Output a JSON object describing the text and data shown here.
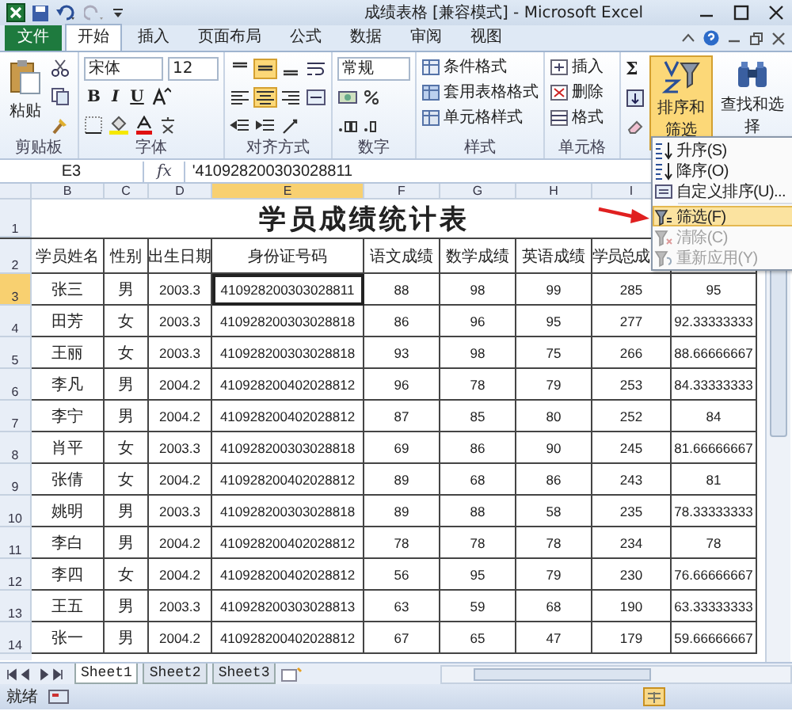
{
  "window": {
    "title": "成绩表格 [兼容模式] - Microsoft Excel"
  },
  "tabs": [
    {
      "label": "文件",
      "kind": "file",
      "selected": false
    },
    {
      "label": "开始",
      "kind": "tab",
      "selected": true
    },
    {
      "label": "插入",
      "kind": "tab",
      "selected": false
    },
    {
      "label": "页面布局",
      "kind": "tab",
      "selected": false
    },
    {
      "label": "公式",
      "kind": "tab",
      "selected": false
    },
    {
      "label": "数据",
      "kind": "tab",
      "selected": false
    },
    {
      "label": "审阅",
      "kind": "tab",
      "selected": false
    },
    {
      "label": "视图",
      "kind": "tab",
      "selected": false
    }
  ],
  "ribbon": {
    "clipboard": {
      "paste": "粘贴",
      "label": "剪贴板"
    },
    "font": {
      "family": "宋体",
      "size": "12",
      "styles": [
        "B",
        "I",
        "U"
      ],
      "label": "字体"
    },
    "alignment": {
      "label": "对齐方式"
    },
    "number": {
      "format": "常规",
      "label": "数字"
    },
    "styles": {
      "items": [
        "条件格式",
        "套用表格格式",
        "单元格样式"
      ],
      "label": "样式"
    },
    "cells": {
      "items": [
        "插入",
        "删除",
        "格式"
      ],
      "label": "单元格"
    },
    "editing": {
      "sum": "Σ",
      "sort_filter": {
        "label": "排序和筛选",
        "pressed": true
      },
      "find": "查找和选择"
    }
  },
  "formula_bar": {
    "name_box": "E3",
    "fx": "fx",
    "formula": "'410928200303028811"
  },
  "sheet": {
    "columns": [
      {
        "label": "B",
        "selected": false
      },
      {
        "label": "C",
        "selected": false
      },
      {
        "label": "D",
        "selected": false
      },
      {
        "label": "E",
        "selected": true
      },
      {
        "label": "F",
        "selected": false
      },
      {
        "label": "G",
        "selected": false
      },
      {
        "label": "H",
        "selected": false
      },
      {
        "label": "I",
        "selected": false
      }
    ],
    "rows": [
      {
        "number": "1",
        "kind": "title",
        "selected": false,
        "cells": [
          "",
          "",
          "",
          "学员成绩统计表"
        ]
      },
      {
        "number": "2",
        "kind": "header",
        "selected": false,
        "cells": [
          "学员姓名",
          "性别",
          "出生日期",
          "身份证号码",
          "语文成绩",
          "数学成绩",
          "英语成绩",
          "学员总成"
        ]
      },
      {
        "number": "3",
        "kind": "data",
        "selected": true,
        "cells": [
          "张三",
          "男",
          "2003.3",
          "410928200303028811",
          "88",
          "98",
          "99",
          "285",
          "95"
        ]
      },
      {
        "number": "4",
        "kind": "data",
        "selected": false,
        "cells": [
          "田芳",
          "女",
          "2003.3",
          "410928200303028818",
          "86",
          "96",
          "95",
          "277",
          "92.33333333"
        ]
      },
      {
        "number": "5",
        "kind": "data",
        "selected": false,
        "cells": [
          "王丽",
          "女",
          "2003.3",
          "410928200303028818",
          "93",
          "98",
          "75",
          "266",
          "88.66666667"
        ]
      },
      {
        "number": "6",
        "kind": "data",
        "selected": false,
        "cells": [
          "李凡",
          "男",
          "2004.2",
          "410928200402028812",
          "96",
          "78",
          "79",
          "253",
          "84.33333333"
        ]
      },
      {
        "number": "7",
        "kind": "data",
        "selected": false,
        "cells": [
          "李宁",
          "男",
          "2004.2",
          "410928200402028812",
          "87",
          "85",
          "80",
          "252",
          "84"
        ]
      },
      {
        "number": "8",
        "kind": "data",
        "selected": false,
        "cells": [
          "肖平",
          "女",
          "2003.3",
          "410928200303028818",
          "69",
          "86",
          "90",
          "245",
          "81.66666667"
        ]
      },
      {
        "number": "9",
        "kind": "data",
        "selected": false,
        "cells": [
          "张倩",
          "女",
          "2004.2",
          "410928200402028812",
          "89",
          "68",
          "86",
          "243",
          "81"
        ]
      },
      {
        "number": "10",
        "kind": "data",
        "selected": false,
        "cells": [
          "姚明",
          "男",
          "2003.3",
          "410928200303028818",
          "89",
          "88",
          "58",
          "235",
          "78.33333333"
        ]
      },
      {
        "number": "11",
        "kind": "data",
        "selected": false,
        "cells": [
          "李白",
          "男",
          "2004.2",
          "410928200402028812",
          "78",
          "78",
          "78",
          "234",
          "78"
        ]
      },
      {
        "number": "12",
        "kind": "data",
        "selected": false,
        "cells": [
          "李四",
          "女",
          "2004.2",
          "410928200402028812",
          "56",
          "95",
          "79",
          "230",
          "76.66666667"
        ]
      },
      {
        "number": "13",
        "kind": "data",
        "selected": false,
        "cells": [
          "王五",
          "男",
          "2003.3",
          "410928200303028813",
          "63",
          "59",
          "68",
          "190",
          "63.33333333"
        ]
      },
      {
        "number": "14",
        "kind": "data",
        "selected": false,
        "cells": [
          "张一",
          "男",
          "2004.2",
          "410928200402028812",
          "67",
          "65",
          "47",
          "179",
          "59.66666667"
        ]
      }
    ]
  },
  "menu": [
    {
      "label": "升序(S)",
      "kind": "asc",
      "selected": false,
      "disabled": false
    },
    {
      "label": "降序(O)",
      "kind": "desc",
      "selected": false,
      "disabled": false
    },
    {
      "label": "自定义排序(U)...",
      "kind": "custom",
      "selected": false,
      "disabled": false
    },
    {
      "label": "筛选(F)",
      "kind": "filter",
      "selected": true,
      "disabled": false
    },
    {
      "label": "清除(C)",
      "kind": "clear",
      "selected": false,
      "disabled": true
    },
    {
      "label": "重新应用(Y)",
      "kind": "reapply",
      "selected": false,
      "disabled": true
    }
  ],
  "sheet_tabs": [
    {
      "label": "Sheet1",
      "selected": true
    },
    {
      "label": "Sheet2",
      "selected": false
    },
    {
      "label": "Sheet3",
      "selected": false
    }
  ],
  "status_bar": {
    "text": "就绪"
  }
}
